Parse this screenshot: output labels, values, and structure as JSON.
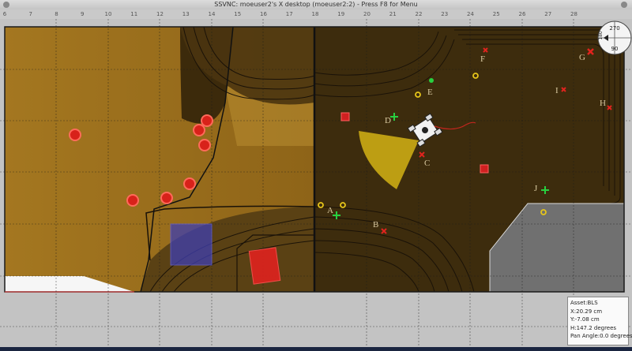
{
  "window": {
    "title": "SSVNC: moeuser2's X desktop (moeuser2:2) - Press F8 for Menu"
  },
  "ruler": {
    "ticks": [
      "6",
      "7",
      "8",
      "9",
      "10",
      "11",
      "12",
      "13",
      "14",
      "15",
      "16",
      "17",
      "18",
      "19",
      "20",
      "21",
      "22",
      "23",
      "24",
      "25",
      "26",
      "27",
      "28"
    ]
  },
  "markers": [
    {
      "label": "A",
      "type": "red-x"
    },
    {
      "label": "B",
      "type": "red-x"
    },
    {
      "label": "C",
      "type": "red-x"
    },
    {
      "label": "D",
      "type": "green-cross"
    },
    {
      "label": "E",
      "type": "green-dot"
    },
    {
      "label": "F",
      "type": "red-x"
    },
    {
      "label": "G",
      "type": "red-x"
    },
    {
      "label": "H",
      "type": "red-x"
    },
    {
      "label": "I",
      "type": "red-x"
    },
    {
      "label": "J",
      "type": "green-cross"
    }
  ],
  "compass": {
    "top": "270",
    "left": "180",
    "bottom": "90"
  },
  "info": {
    "asset": "Asset:BLS",
    "x": "X:20.29 cm",
    "y": "Y:-7.08 cm",
    "h": "H:147.2 degrees",
    "pan": "Pan Angle:0.0 degrees"
  },
  "colors": {
    "terrain_left": "#a37a22",
    "terrain_right": "#3b2a0c",
    "hazard": "#e0231e",
    "beacon": "#e6c51a",
    "fov": "#d4b315",
    "goal_box": "#3f3fb0",
    "grey_zone": "#6f6f6f"
  }
}
